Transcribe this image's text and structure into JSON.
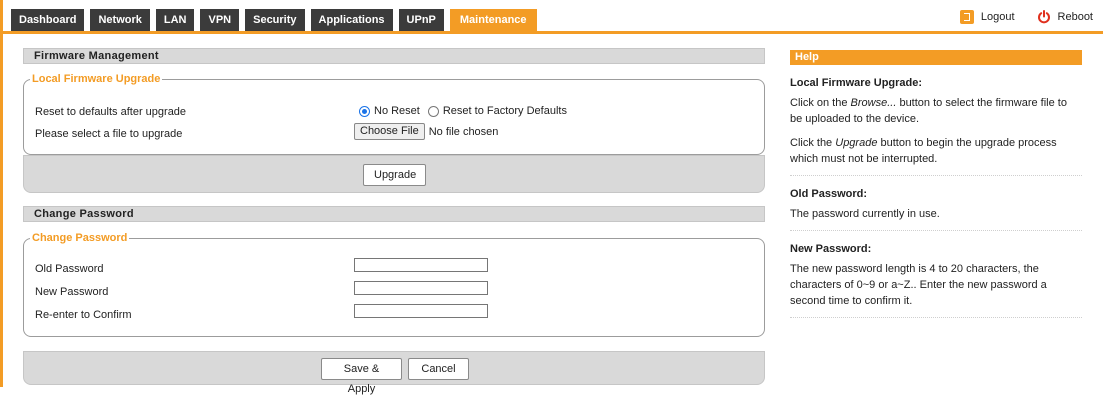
{
  "nav": {
    "tabs": [
      {
        "label": "Dashboard"
      },
      {
        "label": "Network"
      },
      {
        "label": "LAN"
      },
      {
        "label": "VPN"
      },
      {
        "label": "Security"
      },
      {
        "label": "Applications"
      },
      {
        "label": "UPnP"
      },
      {
        "label": "Maintenance",
        "active": true
      }
    ],
    "logout_label": "Logout",
    "reboot_label": "Reboot"
  },
  "firmware": {
    "section_title": "Firmware Management",
    "legend": "Local Firmware Upgrade",
    "reset_label": "Reset to defaults after upgrade",
    "reset_options": [
      "No Reset",
      "Reset to Factory Defaults"
    ],
    "reset_selected": "No Reset",
    "file_label": "Please select a file to upgrade",
    "file_button": "Choose File",
    "file_status": "No file chosen",
    "upgrade_button": "Upgrade"
  },
  "password": {
    "section_title": "Change Password",
    "legend": "Change Password",
    "old_label": "Old Password",
    "new_label": "New Password",
    "confirm_label": "Re-enter to Confirm",
    "old_value": "",
    "new_value": "",
    "confirm_value": "",
    "save_button": "Save & Apply",
    "cancel_button": "Cancel"
  },
  "help": {
    "title": "Help",
    "firmware_heading": "Local Firmware Upgrade:",
    "firmware_text_1_pre": "Click on the ",
    "firmware_text_1_em": "Browse...",
    "firmware_text_1_post": " button to select the firmware file to be uploaded to the device.",
    "firmware_text_2_pre": "Click the ",
    "firmware_text_2_em": "Upgrade",
    "firmware_text_2_post": " button to begin the upgrade process which must not be interrupted.",
    "old_pw_heading": "Old Password:",
    "old_pw_text": "The password currently in use.",
    "new_pw_heading": "New Password:",
    "new_pw_text": "The new password length is 4 to 20 characters, the characters of 0~9 or a~Z.. Enter the new password a second time to confirm it."
  },
  "colors": {
    "accent": "#f39c25",
    "tab_bg": "#3b3b3b",
    "section_bg": "#d9d9d9"
  }
}
